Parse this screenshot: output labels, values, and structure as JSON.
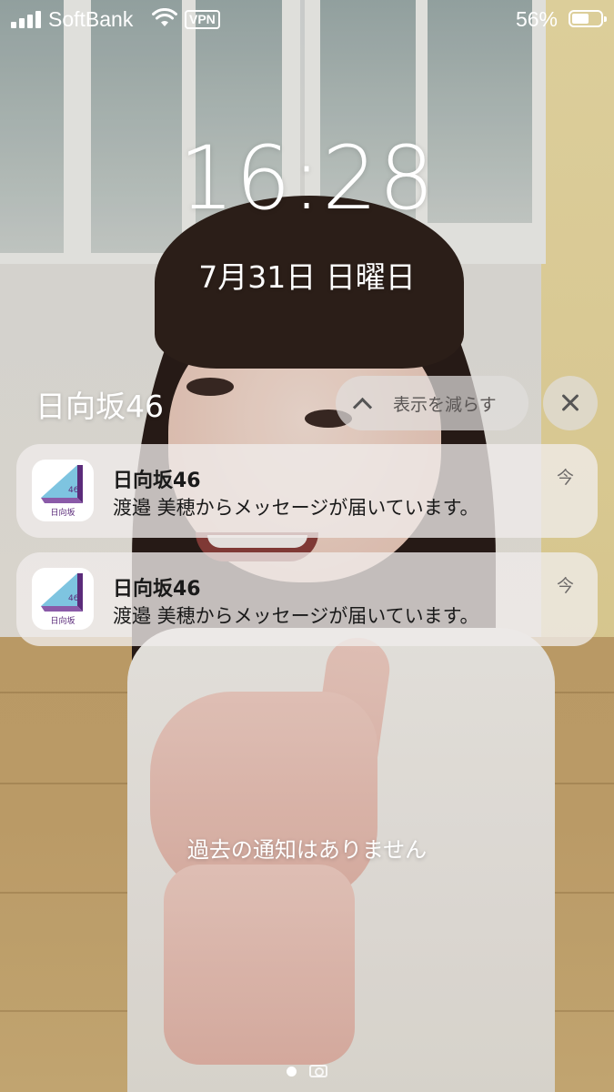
{
  "status_bar": {
    "carrier": "SoftBank",
    "vpn": "VPN",
    "battery": "56%"
  },
  "lock": {
    "time": "16:28",
    "date": "7月31日 日曜日"
  },
  "notification_group": {
    "app": "日向坂46",
    "show_less": "表示を減らす",
    "items": [
      {
        "app": "日向坂46",
        "message": "渡邉 美穂からメッセージが届いています。",
        "time": "今"
      },
      {
        "app": "日向坂46",
        "message": "渡邉 美穂からメッセージが届いています。",
        "time": "今"
      }
    ]
  },
  "no_older_notifications": "過去の通知はありません",
  "app_icon_label": "日向坂",
  "app_icon_number": "46"
}
